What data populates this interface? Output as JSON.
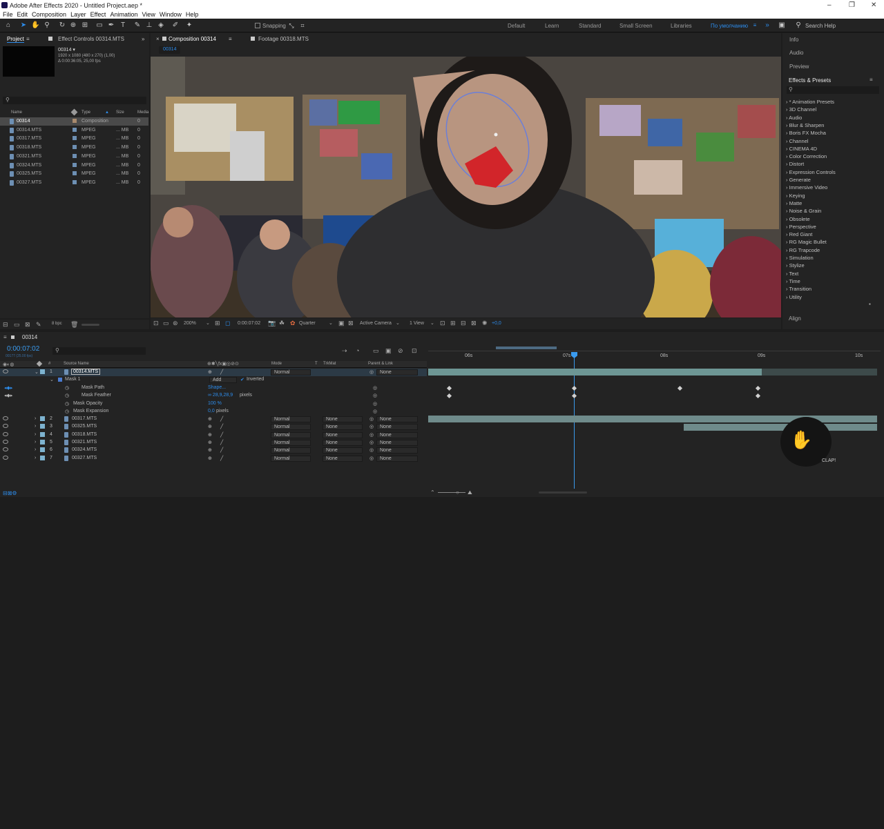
{
  "app_title": "Adobe After Effects 2020 - Untitled Project.aep *",
  "menu": [
    "File",
    "Edit",
    "Composition",
    "Layer",
    "Effect",
    "Animation",
    "View",
    "Window",
    "Help"
  ],
  "toolbar": {
    "snapping": "Snapping",
    "workspaces": [
      "Default",
      "Learn",
      "Standard",
      "Small Screen",
      "Libraries",
      "По умолчанию"
    ],
    "active_workspace_index": 5,
    "search_help": "Search Help"
  },
  "project_panel": {
    "tab_project": "Project",
    "tab_effect_controls": "Effect Controls 00314.MTS",
    "selected_name": "00314 ▾",
    "info_line1": "1920 x 1080  (480 x 270) (1,00)",
    "info_line2": "Δ 0:00:36:05, 25,00 fps",
    "col_name": "Name",
    "col_type": "Type",
    "col_size": "Size",
    "col_media": "Media",
    "bpc": "8 bpc",
    "items": [
      {
        "name": "00314",
        "type": "Composition",
        "size": "",
        "color": "#a88a6d",
        "selected": true
      },
      {
        "name": "00314.MTS",
        "type": "MPEG",
        "size": "... MB",
        "color": "#6d8fb3"
      },
      {
        "name": "00317.MTS",
        "type": "MPEG",
        "size": "... MB",
        "color": "#6d8fb3"
      },
      {
        "name": "00318.MTS",
        "type": "MPEG",
        "size": "... MB",
        "color": "#6d8fb3"
      },
      {
        "name": "00321.MTS",
        "type": "MPEG",
        "size": "... MB",
        "color": "#6d8fb3"
      },
      {
        "name": "00324.MTS",
        "type": "MPEG",
        "size": "... MB",
        "color": "#6d8fb3"
      },
      {
        "name": "00325.MTS",
        "type": "MPEG",
        "size": "... MB",
        "color": "#6d8fb3"
      },
      {
        "name": "00327.MTS",
        "type": "MPEG",
        "size": "... MB",
        "color": "#6d8fb3"
      }
    ],
    "media_val": "0"
  },
  "composition_panel": {
    "tab_comp": "Composition 00314",
    "tab_footage": "Footage 00318.MTS",
    "comp_chip": "00314",
    "zoom": "200%",
    "timecode": "0:00:07:02",
    "resolution": "Quarter",
    "camera": "Active Camera",
    "views": "1 View",
    "exposure": "+0,0"
  },
  "right_panel": {
    "info": "Info",
    "audio": "Audio",
    "preview": "Preview",
    "effects_title": "Effects & Presets",
    "align": "Align",
    "effects": [
      "* Animation Presets",
      "3D Channel",
      "Audio",
      "Blur & Sharpen",
      "Boris FX Mocha",
      "Channel",
      "CINEMA 4D",
      "Color Correction",
      "Distort",
      "Expression Controls",
      "Generate",
      "Immersive Video",
      "Keying",
      "Matte",
      "Noise & Grain",
      "Obsolete",
      "Perspective",
      "Red Giant",
      "RG Magic Bullet",
      "RG Trapcode",
      "Simulation",
      "Stylize",
      "Text",
      "Time",
      "Transition",
      "Utility"
    ]
  },
  "timeline": {
    "tab": "00314",
    "current_time": "0:00:07:02",
    "frame_info": "00177 (25.00 fps)",
    "col_source": "Source Name",
    "col_mode": "Mode",
    "col_t": "T",
    "col_trkmat": "TrkMat",
    "col_parent": "Parent & Link",
    "ruler": [
      "06s",
      "07s",
      "08s",
      "09s",
      "10s"
    ],
    "layer1": {
      "num": "1",
      "name": "00314.MTS",
      "mode": "Normal",
      "parent": "None"
    },
    "mask": {
      "name": "Mask 1",
      "mode": "Add",
      "inverted": "Inverted"
    },
    "mask_props": [
      {
        "name": "Mask Path",
        "value": "Shape..."
      },
      {
        "name": "Mask Feather",
        "value": "∞ 28,9,28,9",
        "unit": "pixels"
      },
      {
        "name": "Mask Opacity",
        "value": "100 %",
        "unit": ""
      },
      {
        "name": "Mask Expansion",
        "value": "0,0",
        "unit": "pixels"
      }
    ],
    "layers": [
      {
        "num": "2",
        "name": "00317.MTS",
        "mode": "Normal",
        "trkmat": "None",
        "parent": "None"
      },
      {
        "num": "3",
        "name": "00325.MTS",
        "mode": "Normal",
        "trkmat": "None",
        "parent": "None"
      },
      {
        "num": "4",
        "name": "00318.MTS",
        "mode": "Normal",
        "trkmat": "None",
        "parent": "None"
      },
      {
        "num": "5",
        "name": "00321.MTS",
        "mode": "Normal",
        "trkmat": "None",
        "parent": "None"
      },
      {
        "num": "6",
        "name": "00324.MTS",
        "mode": "Normal",
        "trkmat": "None",
        "parent": "None"
      },
      {
        "num": "7",
        "name": "00327.MTS",
        "mode": "Normal",
        "trkmat": "None",
        "parent": "None"
      }
    ]
  },
  "watermark": "CLAP!"
}
